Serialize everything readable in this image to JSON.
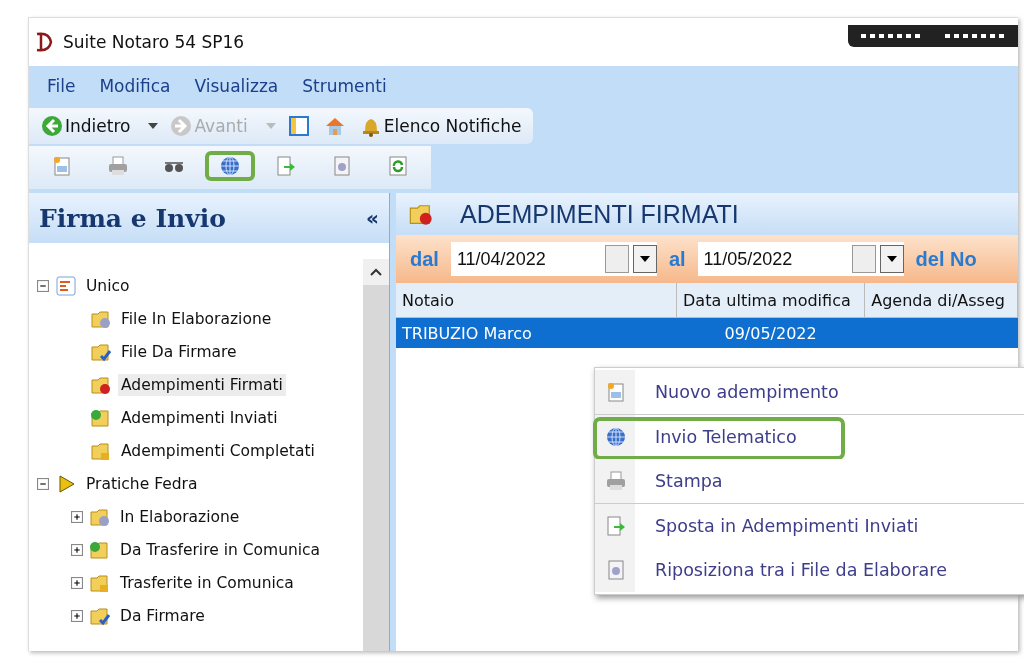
{
  "window": {
    "title": "Suite Notaro 54 SP16"
  },
  "menu": [
    "File",
    "Modifica",
    "Visualizza",
    "Strumenti"
  ],
  "toolbar": [
    {
      "kind": "back",
      "label": "Indietro",
      "disabled": false
    },
    {
      "kind": "forward",
      "label": "Avanti",
      "disabled": true
    },
    {
      "kind": "panel"
    },
    {
      "kind": "home"
    },
    {
      "kind": "bell",
      "label": "Elenco Notifiche"
    }
  ],
  "toolbar2": [
    {
      "kind": "new",
      "highlighted": false
    },
    {
      "kind": "print",
      "highlighted": false
    },
    {
      "kind": "glasses",
      "highlighted": false
    },
    {
      "kind": "globe",
      "highlighted": true
    },
    {
      "kind": "move",
      "highlighted": false
    },
    {
      "kind": "doc",
      "highlighted": false
    },
    {
      "kind": "refresh",
      "highlighted": false
    }
  ],
  "sidebar": {
    "title": "Firma e Invio",
    "collapse": "«",
    "tree": [
      {
        "label": "Unico",
        "kind": "list",
        "expanded": true,
        "selected": false,
        "children": [
          {
            "label": "File In Elaborazione",
            "kind": "gear",
            "selected": false
          },
          {
            "label": "File Da Firmare",
            "kind": "check",
            "selected": false
          },
          {
            "label": "Adempimenti Firmati",
            "kind": "seal",
            "selected": true
          },
          {
            "label": "Adempimenti Inviati",
            "kind": "send",
            "selected": false
          },
          {
            "label": "Adempimenti Completati",
            "kind": "lock",
            "selected": false
          }
        ]
      },
      {
        "label": "Pratiche Fedra",
        "kind": "arrow",
        "expanded": true,
        "selected": false,
        "children": [
          {
            "label": "In Elaborazione",
            "kind": "gear",
            "expanded": false,
            "selected": false
          },
          {
            "label": "Da Trasferire in Comunica",
            "kind": "send",
            "expanded": false,
            "selected": false
          },
          {
            "label": "Trasferite in Comunica",
            "kind": "lock",
            "expanded": false,
            "selected": false
          },
          {
            "label": "Da Firmare",
            "kind": "check",
            "expanded": false,
            "selected": false
          }
        ]
      }
    ]
  },
  "content": {
    "title": "ADEMPIMENTI FIRMATI",
    "filters": [
      {
        "label": "dal",
        "value": "11/04/2022"
      },
      {
        "label": "al",
        "value": "11/05/2022"
      }
    ],
    "filter_more": "del No",
    "table": {
      "columns": [
        "Notaio",
        "Data ultima modifica",
        "Agenda di/Asseg"
      ],
      "rows": [
        {
          "cells": [
            "TRIBUZIO Marco",
            "09/05/2022",
            ""
          ],
          "selected": true
        }
      ]
    }
  },
  "context_menu": [
    {
      "label": "Nuovo adempimento",
      "kind": "new",
      "highlighted": false
    },
    {
      "label": "Invio Telematico",
      "kind": "globe",
      "highlighted": true
    },
    {
      "label": "Stampa",
      "kind": "print",
      "highlighted": false
    },
    {
      "label": "Sposta in Adempimenti Inviati",
      "kind": "move",
      "highlighted": false
    },
    {
      "label": "Riposiziona tra i File da Elaborare",
      "kind": "doc",
      "highlighted": false
    }
  ]
}
